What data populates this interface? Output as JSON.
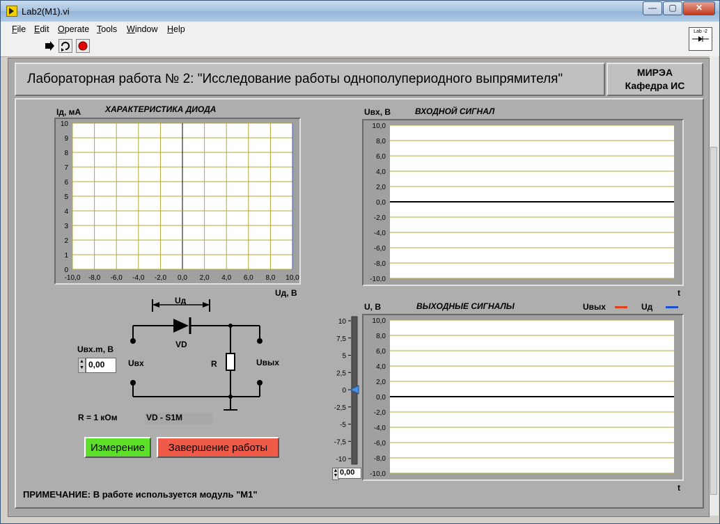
{
  "window": {
    "title": "Lab2(M1).vi",
    "min": "—",
    "max": "▢",
    "close": "✕"
  },
  "menu": [
    "File",
    "Edit",
    "Operate",
    "Tools",
    "Window",
    "Help"
  ],
  "toolbar_icon_label": "Lab -2",
  "header": {
    "title": "Лабораторная работа № 2: \"Исследование работы однополупериодного выпрямителя\"",
    "org_line1": "МИРЭА",
    "org_line2": "Кафедра ИС"
  },
  "diode_chart": {
    "title": "ХАРАКТЕРИСТИКА ДИОДА",
    "ylabel": "Iд, мА",
    "xlabel": "Uд, В",
    "yticks": [
      "10",
      "9",
      "8",
      "7",
      "6",
      "5",
      "4",
      "3",
      "2",
      "1",
      "0"
    ],
    "xticks": [
      "-10,0",
      "-8,0",
      "-6,0",
      "-4,0",
      "-2,0",
      "0,0",
      "2,0",
      "4,0",
      "6,0",
      "8,0",
      "10,0"
    ]
  },
  "input_chart": {
    "title": "ВХОДНОЙ СИГНАЛ",
    "ylabel": "Uвх, В",
    "xlabel": "t",
    "yticks": [
      "10,0",
      "8,0",
      "6,0",
      "4,0",
      "2,0",
      "0,0",
      "-2,0",
      "-4,0",
      "-6,0",
      "-8,0",
      "-10,0"
    ]
  },
  "output_chart": {
    "title": "ВЫХОДНЫЕ СИГНАЛЫ",
    "ylabel": "U, В",
    "xlabel": "t",
    "yticks": [
      "10,0",
      "8,0",
      "6,0",
      "4,0",
      "2,0",
      "0,0",
      "-2,0",
      "-4,0",
      "-6,0",
      "-8,0",
      "-10,0"
    ],
    "legend": [
      {
        "name": "Uвых",
        "color": "#e0401a"
      },
      {
        "name": "Uд",
        "color": "#1a4fd0"
      }
    ]
  },
  "slider": {
    "ticks": [
      "10",
      "7,5",
      "5",
      "2,5",
      "0",
      "-2,5",
      "-5",
      "-7,5",
      "-10"
    ],
    "value_display": "0,00"
  },
  "circuit": {
    "ud_label": "Uд",
    "vd_label": "VD",
    "r_label": "R",
    "uin_label": "Uвх",
    "uout_label": "Uвых",
    "r_value": "R = 1 кОм",
    "vd_value": "VD - S1M"
  },
  "amplitude": {
    "label": "Uвх.m, В",
    "value": "0,00"
  },
  "buttons": {
    "measure": "Измерение",
    "finish": "Завершение работы"
  },
  "note": "ПРИМЕЧАНИЕ: В работе используется модуль \"М1\""
}
